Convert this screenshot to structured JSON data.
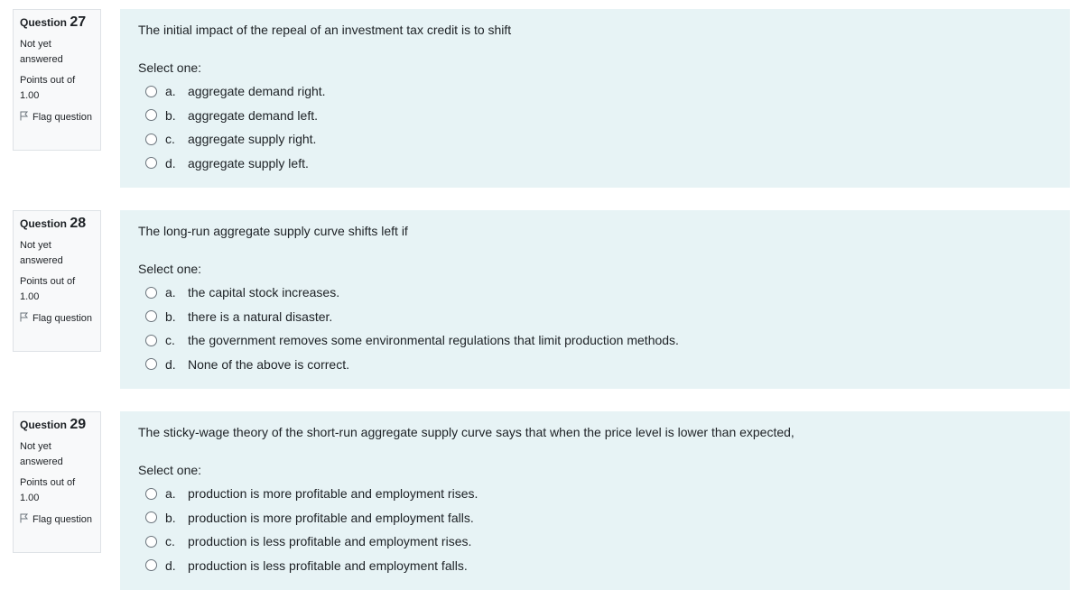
{
  "questions": [
    {
      "label": "Question",
      "number": "27",
      "state": "Not yet answered",
      "grade": "Points out of 1.00",
      "flag": "Flag question",
      "text": "The initial impact of the repeal of an investment tax credit is to shift",
      "prompt": "Select one:",
      "options": [
        {
          "letter": "a.",
          "text": "aggregate demand right."
        },
        {
          "letter": "b.",
          "text": "aggregate demand left."
        },
        {
          "letter": "c.",
          "text": "aggregate supply right."
        },
        {
          "letter": "d.",
          "text": "aggregate supply left."
        }
      ]
    },
    {
      "label": "Question",
      "number": "28",
      "state": "Not yet answered",
      "grade": "Points out of 1.00",
      "flag": "Flag question",
      "text": "The long-run aggregate supply curve shifts left if",
      "prompt": "Select one:",
      "options": [
        {
          "letter": "a.",
          "text": "the capital stock increases."
        },
        {
          "letter": "b.",
          "text": "there is a natural disaster."
        },
        {
          "letter": "c.",
          "text": "the government removes some environmental regulations that limit production methods."
        },
        {
          "letter": "d.",
          "text": "None of the above is correct."
        }
      ]
    },
    {
      "label": "Question",
      "number": "29",
      "state": "Not yet answered",
      "grade": "Points out of 1.00",
      "flag": "Flag question",
      "text": "The sticky-wage theory of the short-run aggregate supply curve says that when the price level is lower than expected,",
      "prompt": "Select one:",
      "options": [
        {
          "letter": "a.",
          "text": "production is more profitable and employment rises."
        },
        {
          "letter": "b.",
          "text": "production is more profitable and employment falls."
        },
        {
          "letter": "c.",
          "text": "production is less profitable and employment rises."
        },
        {
          "letter": "d.",
          "text": "production is less profitable and employment falls."
        }
      ]
    }
  ]
}
